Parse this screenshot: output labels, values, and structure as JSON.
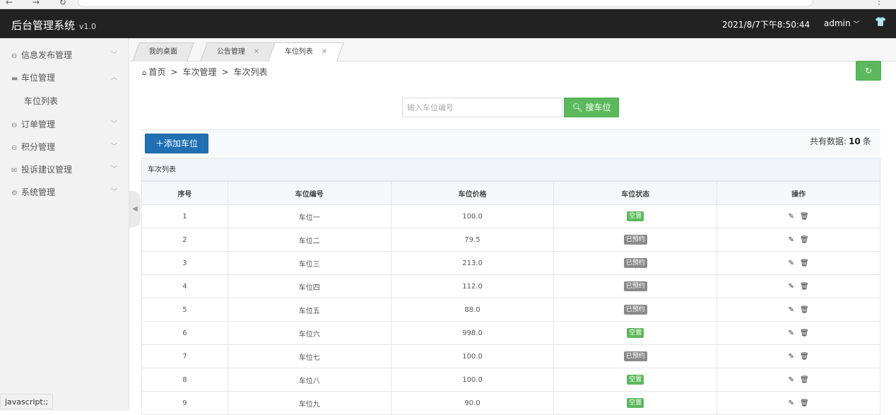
{
  "header": {
    "brand": "后台管理系统",
    "version": "v1.0",
    "datetime": "2021/8/7下午8:50:44",
    "user": "admin"
  },
  "sidebar": {
    "items": [
      {
        "label": "信息发布管理",
        "icon": "minus-circle-icon",
        "arrow": "﹀"
      },
      {
        "label": "车位管理",
        "icon": "truck-icon",
        "arrow": "︿"
      },
      {
        "label": "订单管理",
        "icon": "lock-icon",
        "arrow": "﹀"
      },
      {
        "label": "积分管理",
        "icon": "minus-circle-icon",
        "arrow": "﹀"
      },
      {
        "label": "投诉建议管理",
        "icon": "mail-icon",
        "arrow": "﹀"
      },
      {
        "label": "系统管理",
        "icon": "gear-icon",
        "arrow": "﹀"
      }
    ],
    "sub_items": [
      "车位列表"
    ]
  },
  "tabs": [
    {
      "label": "我的桌面"
    },
    {
      "label": "公告管理"
    },
    {
      "label": "车位列表"
    }
  ],
  "breadcrumb": [
    "首页",
    "车次管理",
    "车次列表"
  ],
  "search": {
    "placeholder": "输入车位编号",
    "button_label": "搜车位"
  },
  "toolbar": {
    "add_label": "添加车位",
    "total_prefix": "共有数据:",
    "total_count": "10",
    "total_suffix": "条"
  },
  "table": {
    "title": "车次列表",
    "headers": [
      "序号",
      "车位编号",
      "车位价格",
      "车位状态",
      "操作"
    ],
    "rows": [
      {
        "no": "1",
        "code": "车位一",
        "price": "100.0",
        "status": "空置",
        "free": true
      },
      {
        "no": "2",
        "code": "车位二",
        "price": "79.5",
        "status": "已预约",
        "free": false
      },
      {
        "no": "3",
        "code": "车位三",
        "price": "213.0",
        "status": "已预约",
        "free": false
      },
      {
        "no": "4",
        "code": "车位四",
        "price": "112.0",
        "status": "已预约",
        "free": false
      },
      {
        "no": "5",
        "code": "车位五",
        "price": "88.0",
        "status": "已预约",
        "free": false
      },
      {
        "no": "6",
        "code": "车位六",
        "price": "998.0",
        "status": "空置",
        "free": true
      },
      {
        "no": "7",
        "code": "车位七",
        "price": "100.0",
        "status": "已预约",
        "free": false
      },
      {
        "no": "8",
        "code": "车位八",
        "price": "100.0",
        "status": "空置",
        "free": true
      },
      {
        "no": "9",
        "code": "车位九",
        "price": "90.0",
        "status": "空置",
        "free": true
      }
    ]
  },
  "statusbar": "javascript:;",
  "colors": {
    "topbar": "#222222",
    "green": "#5cb85c",
    "blue": "#1f6fb2",
    "booked": "#8a8a8a"
  }
}
